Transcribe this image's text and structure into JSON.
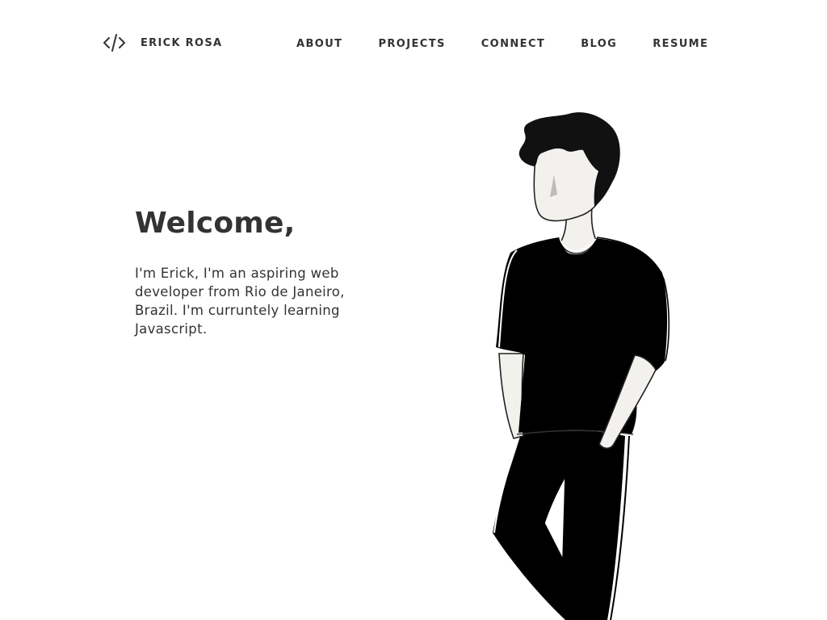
{
  "header": {
    "logo_icon": "code-brackets-icon",
    "logo_text": "ERICK ROSA"
  },
  "nav": {
    "items": [
      {
        "label": "ABOUT"
      },
      {
        "label": "PROJECTS"
      },
      {
        "label": "CONNECT"
      },
      {
        "label": "BLOG"
      },
      {
        "label": "RESUME"
      }
    ]
  },
  "hero": {
    "title": "Welcome,",
    "intro": "I'm Erick, I'm an aspiring web developer from Rio de Janeiro, Brazil. I'm curruntely learning Javascript.",
    "illustration_icon": "person-illustration"
  },
  "colors": {
    "background": "#ffffff",
    "text": "#333333",
    "illustration_dark": "#000000",
    "skin": "#f3f1ee"
  }
}
